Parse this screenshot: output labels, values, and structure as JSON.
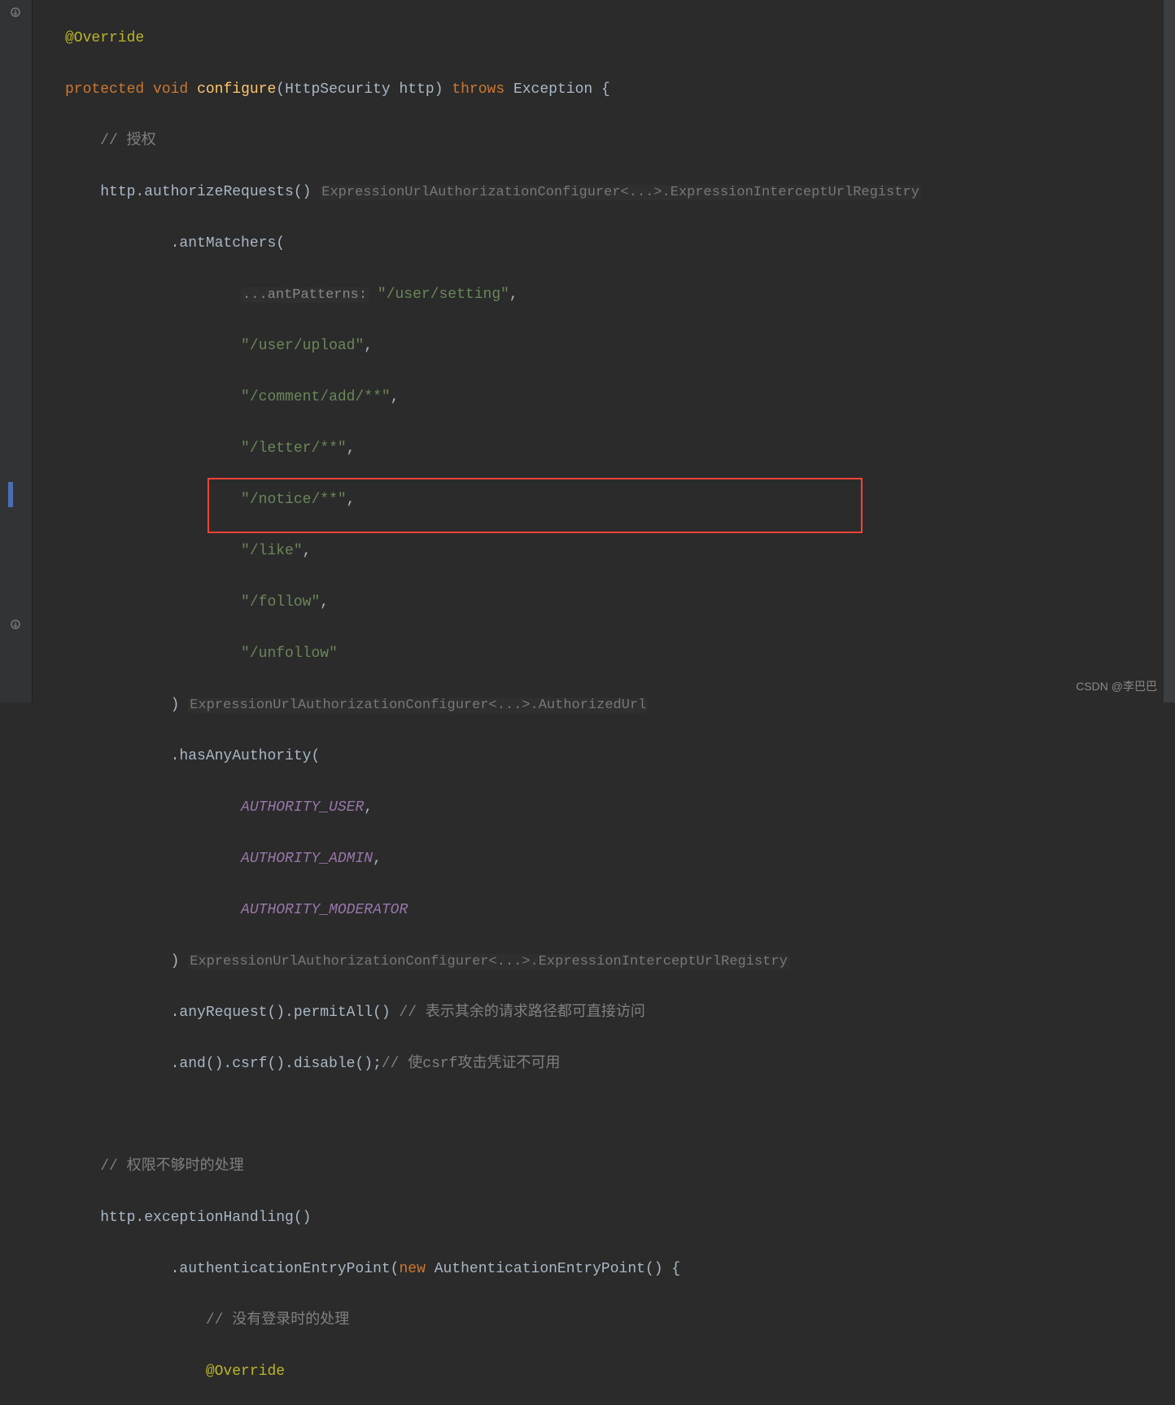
{
  "code": {
    "override_annotation": "@Override",
    "protected": "protected",
    "void": "void",
    "configure": "configure",
    "httpsecurity": "(HttpSecurity http)",
    "throws": "throws",
    "exception": "Exception {",
    "comment_auth": "// 授权",
    "http_authorize": "http.authorizeRequests()",
    "hint1": "ExpressionUrlAuthorizationConfigurer<...>.ExpressionInterceptUrlRegistry",
    "antmatchers": ".antMatchers(",
    "hint_antpatterns": "...antPatterns:",
    "str_user_setting": "\"/user/setting\"",
    "str_user_upload": "\"/user/upload\"",
    "str_comment_add": "\"/comment/add/**\"",
    "str_letter": "\"/letter/**\"",
    "str_notice": "\"/notice/**\"",
    "str_like": "\"/like\"",
    "str_follow": "\"/follow\"",
    "str_unfollow": "\"/unfollow\"",
    "close_paren": ")",
    "hint2": "ExpressionUrlAuthorizationConfigurer<...>.AuthorizedUrl",
    "hasanyauthority": ".hasAnyAuthority(",
    "auth_user": "AUTHORITY_USER",
    "auth_admin": "AUTHORITY_ADMIN",
    "auth_moderator": "AUTHORITY_MODERATOR",
    "hint3": "ExpressionUrlAuthorizationConfigurer<...>.ExpressionInterceptUrlRegistry",
    "anyrequest": ".anyRequest().permitAll()",
    "comment_anyrequest": "// 表示其余的请求路径都可直接访问",
    "and_csrf": ".and().csrf().disable();",
    "comment_csrf": "// 使csrf攻击凭证不可用",
    "comment_perm": "// 权限不够时的处理",
    "http_exception": "http.exceptionHandling()",
    "auth_entry": ".authenticationEntryPoint(",
    "new_kw": "new",
    "auth_entry_class": "AuthenticationEntryPoint() {",
    "comment_nologin": "// 没有登录时的处理",
    "override2": "@Override"
  },
  "watermark": "CSDN @李巴巴"
}
